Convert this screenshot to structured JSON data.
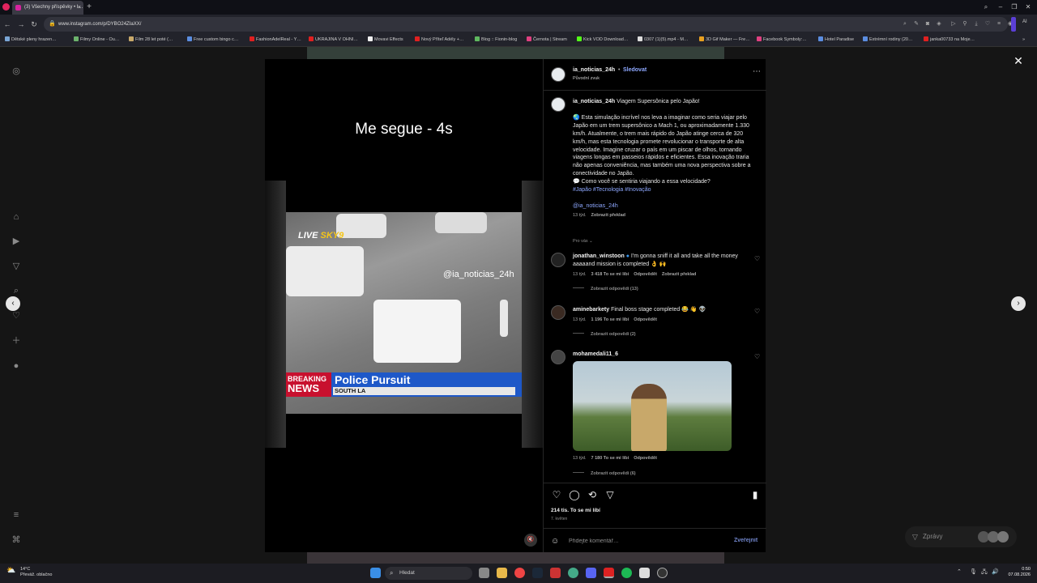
{
  "browser": {
    "tab_title": "(3) Všechny příspěvky • I…",
    "url": "www.instagram.com/p/DYBO24ZIaXX/",
    "ai_label": "AI",
    "bookmarks": [
      {
        "label": "Dětské pleny hrazen…",
        "color": "#7aa6d6"
      },
      {
        "label": "Filmy Online - Ou…",
        "color": "#6cb26c"
      },
      {
        "label": "Film 28 let poté (…",
        "color": "#c9a96a"
      },
      {
        "label": "Free custom bingo c…",
        "color": "#5b8de0"
      },
      {
        "label": "FashionAdelReal - Y…",
        "color": "#e02020"
      },
      {
        "label": "UKRAJINA V OHNI…",
        "color": "#e02020"
      },
      {
        "label": "Movavi Effects",
        "color": "#f0f0f0"
      },
      {
        "label": "Nový Příteľ Adély +…",
        "color": "#e02020"
      },
      {
        "label": "Blog :: Fionin-blog",
        "color": "#5fb85f"
      },
      {
        "label": "Černota | Stream",
        "color": "#e04080"
      },
      {
        "label": "Kick VOD Download…",
        "color": "#53fc18"
      },
      {
        "label": "0307 (1)(5).mp4 - M…",
        "color": "#dddddd"
      },
      {
        "label": "3D Gif Maker — Fre…",
        "color": "#e8a020"
      },
      {
        "label": "Facebook Symboly:…",
        "color": "#e04080"
      },
      {
        "label": "Hotel Paradise",
        "color": "#5b8de0"
      },
      {
        "label": "Extrémní rodiny (20…",
        "color": "#5b8de0"
      },
      {
        "label": "janka00733 na Moje…",
        "color": "#e02020"
      }
    ]
  },
  "post": {
    "video": {
      "top_caption": "Me segue - 4s",
      "live_label": "LIVE",
      "channel_label": "SKY9",
      "watermark": "@ia_noticias_24h",
      "breaking_line1": "BREAKING",
      "breaking_line2": "NEWS",
      "headline": "Police Pursuit",
      "location": "SOUTH LA"
    },
    "author": "ia_noticias_24h",
    "follow_label": "Sledovat",
    "audio_label": "Původní zvuk",
    "caption_title": "Viagem Supersônica pelo Japão!",
    "caption_body": "🌏 Esta simulação incrível nos leva a imaginar como seria viajar pelo Japão em um trem supersônico a Mach 1, ou aproximadamente 1.330 km/h. Atualmente, o trem mais rápido do Japão atinge cerca de 320 km/h, mas esta tecnologia promete revolucionar o transporte de alta velocidade. Imagine cruzar o país em um piscar de olhos, tornando viagens longas em passeios rápidos e eficientes. Essa inovação traria não apenas conveniência, mas também uma nova perspectiva sobre a conectividade no Japão.",
    "caption_question": "💬 Como você se sentiria viajando a essa velocidade?",
    "hashtags": "#Japão #Tecnologia #Inovação",
    "mention": "@ia_noticias_24h",
    "caption_age": "13 týd.",
    "translate_label": "Zobrazit překlad",
    "for_you_label": "Pro vás",
    "comments": [
      {
        "user": "jonathan_winstoon",
        "text": "I'm gonna sniff it all and take all the money aaaaand mission is completed 👌 🙌",
        "age": "13 týd.",
        "likes": "3 418 To se mi líbí",
        "reply": "Odpovědět",
        "translate": "Zobrazit překlad",
        "replies": "Zobrazit odpovědi (13)"
      },
      {
        "user": "aminebarkety",
        "text": "Final boss stage completed 😂 👋 👽",
        "age": "13 týd.",
        "likes": "1 196 To se mi líbí",
        "reply": "Odpovědět",
        "replies": "Zobrazit odpovědi (2)"
      },
      {
        "user": "mohamedali11_6",
        "age": "13 týd.",
        "likes": "7 180 To se mi líbí",
        "reply": "Odpovědět",
        "replies": "Zobrazit odpovědi (6)"
      }
    ],
    "like_count": "214 tis. To se mi líbí",
    "post_date": "7. květen",
    "comment_placeholder": "Přidejte komentář…",
    "publish_label": "Zveřejnit"
  },
  "messages_label": "Zprávy",
  "taskbar": {
    "weather_temp": "14°C",
    "weather_desc": "Převáž. oblačno",
    "search_label": "Hledat",
    "time": "0:50",
    "date": "07.08.2026"
  },
  "colors": {
    "accent": "#8ea8ff",
    "instagram": "#d6249f"
  }
}
